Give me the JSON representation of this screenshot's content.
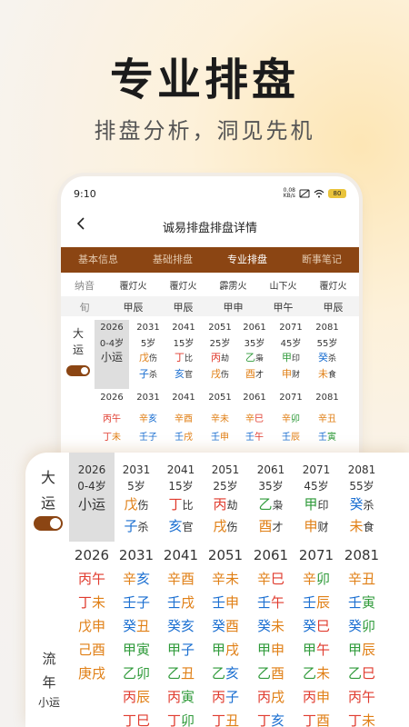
{
  "hero": {
    "title": "专业排盘",
    "subtitle": "排盘分析，洞见先机"
  },
  "status": {
    "time": "9:10",
    "speed_value": "0.08",
    "speed_unit": "KB/s",
    "battery": "80"
  },
  "nav": {
    "title": "诚易排盘排盘详情"
  },
  "tabs": [
    {
      "label": "基本信息",
      "active": false
    },
    {
      "label": "基础排盘",
      "active": false
    },
    {
      "label": "专业排盘",
      "active": true
    },
    {
      "label": "断事笔记",
      "active": false
    }
  ],
  "nayin": {
    "label": "纳音",
    "values": [
      "覆灯火",
      "覆灯火",
      "霹雳火",
      "山下火",
      "覆灯火"
    ]
  },
  "xun": {
    "label": "旬",
    "values": [
      "甲辰",
      "甲辰",
      "甲申",
      "甲午",
      "甲辰"
    ]
  },
  "dayun": {
    "label": "大运",
    "periods": [
      {
        "year": "2026",
        "age": "0-4岁",
        "ganzhi": "小运"
      },
      {
        "year": "2031",
        "age": "5岁",
        "gan": "戊",
        "gan_shen": "伤",
        "zhi": "子",
        "zhi_shen": "杀"
      },
      {
        "year": "2041",
        "age": "15岁",
        "gan": "丁",
        "gan_shen": "比",
        "zhi": "亥",
        "zhi_shen": "官"
      },
      {
        "year": "2051",
        "age": "25岁",
        "gan": "丙",
        "gan_shen": "劫",
        "zhi": "戌",
        "zhi_shen": "伤"
      },
      {
        "year": "2061",
        "age": "35岁",
        "gan": "乙",
        "gan_shen": "枭",
        "zhi": "酉",
        "zhi_shen": "才"
      },
      {
        "year": "2071",
        "age": "45岁",
        "gan": "甲",
        "gan_shen": "印",
        "zhi": "申",
        "zhi_shen": "财"
      },
      {
        "year": "2081",
        "age": "55岁",
        "gan": "癸",
        "gan_shen": "杀",
        "zhi": "未",
        "zhi_shen": "食"
      }
    ]
  },
  "liunian": {
    "label": "流年",
    "sub_label": "小运",
    "years": [
      "2026",
      "2031",
      "2041",
      "2051",
      "2061",
      "2071",
      "2081"
    ],
    "rows": [
      [
        "丙午",
        "辛亥",
        "辛酉",
        "辛未",
        "辛巳",
        "辛卯",
        "辛丑"
      ],
      [
        "丁未",
        "壬子",
        "壬戌",
        "壬申",
        "壬午",
        "壬辰",
        "壬寅"
      ],
      [
        "戊申",
        "癸丑",
        "癸亥",
        "癸酉",
        "癸未",
        "癸巳",
        "癸卯"
      ],
      [
        "己酉",
        "甲寅",
        "甲子",
        "甲戌",
        "甲申",
        "甲午",
        "甲辰"
      ],
      [
        "庚戌",
        "乙卯",
        "乙丑",
        "乙亥",
        "乙酉",
        "乙未",
        "乙巳"
      ],
      [
        "",
        "丙辰",
        "丙寅",
        "丙子",
        "丙戌",
        "丙申",
        "丙午"
      ],
      [
        "",
        "丁巳",
        "丁卯",
        "丁丑",
        "丁亥",
        "丁酉",
        "丁未"
      ]
    ]
  },
  "colors": {
    "brown": "#8b4513",
    "orange": "#e07f15",
    "blue": "#1b6fd1",
    "red": "#e03b2e",
    "green": "#2f9a3a",
    "teal": "#129a8b"
  }
}
